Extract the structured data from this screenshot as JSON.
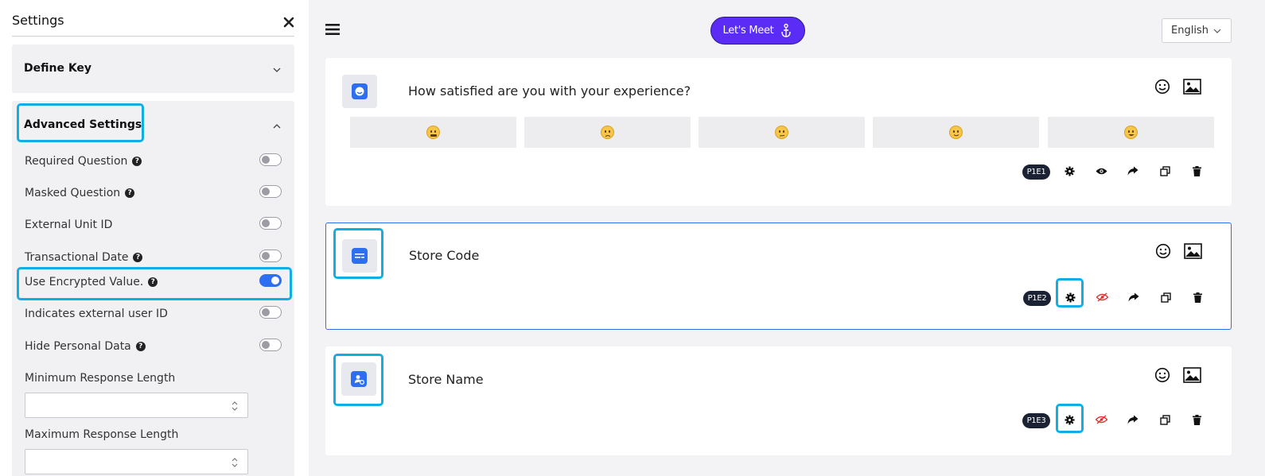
{
  "sidebar": {
    "title": "Settings",
    "define_key": "Define Key",
    "advanced_settings": "Advanced Settings",
    "options": [
      {
        "label": "Required Question",
        "help": true,
        "on": false
      },
      {
        "label": "Masked Question",
        "help": true,
        "on": false
      },
      {
        "label": "External Unit ID",
        "help": false,
        "on": false
      },
      {
        "label": "Transactional Date",
        "help": true,
        "on": false
      },
      {
        "label": "Use Encrypted Value.",
        "help": true,
        "on": true
      },
      {
        "label": "Indicates external user ID",
        "help": false,
        "on": false
      },
      {
        "label": "Hide Personal Data",
        "help": true,
        "on": false
      }
    ],
    "min_length_label": "Minimum Response Length",
    "min_length_value": "",
    "max_length_label": "Maximum Response Length",
    "max_length_value": ""
  },
  "header": {
    "meet_button": "Let's Meet",
    "language": "English"
  },
  "questions": [
    {
      "text": "How satisfied are you with your experience?",
      "badge": "P1E1",
      "icon": "smile-rating-icon"
    },
    {
      "text": "Store Code",
      "badge": "P1E2",
      "icon": "text-field-icon"
    },
    {
      "text": "Store Name",
      "badge": "P1E3",
      "icon": "user-field-icon"
    }
  ],
  "emoji_scale": [
    "very-unhappy",
    "unhappy",
    "neutral",
    "happy",
    "very-happy"
  ],
  "colors": {
    "accent": "#2d6ff0",
    "highlight": "#11aee2",
    "meet": "#5b2cf5",
    "hidden_eye": "#e03131"
  }
}
